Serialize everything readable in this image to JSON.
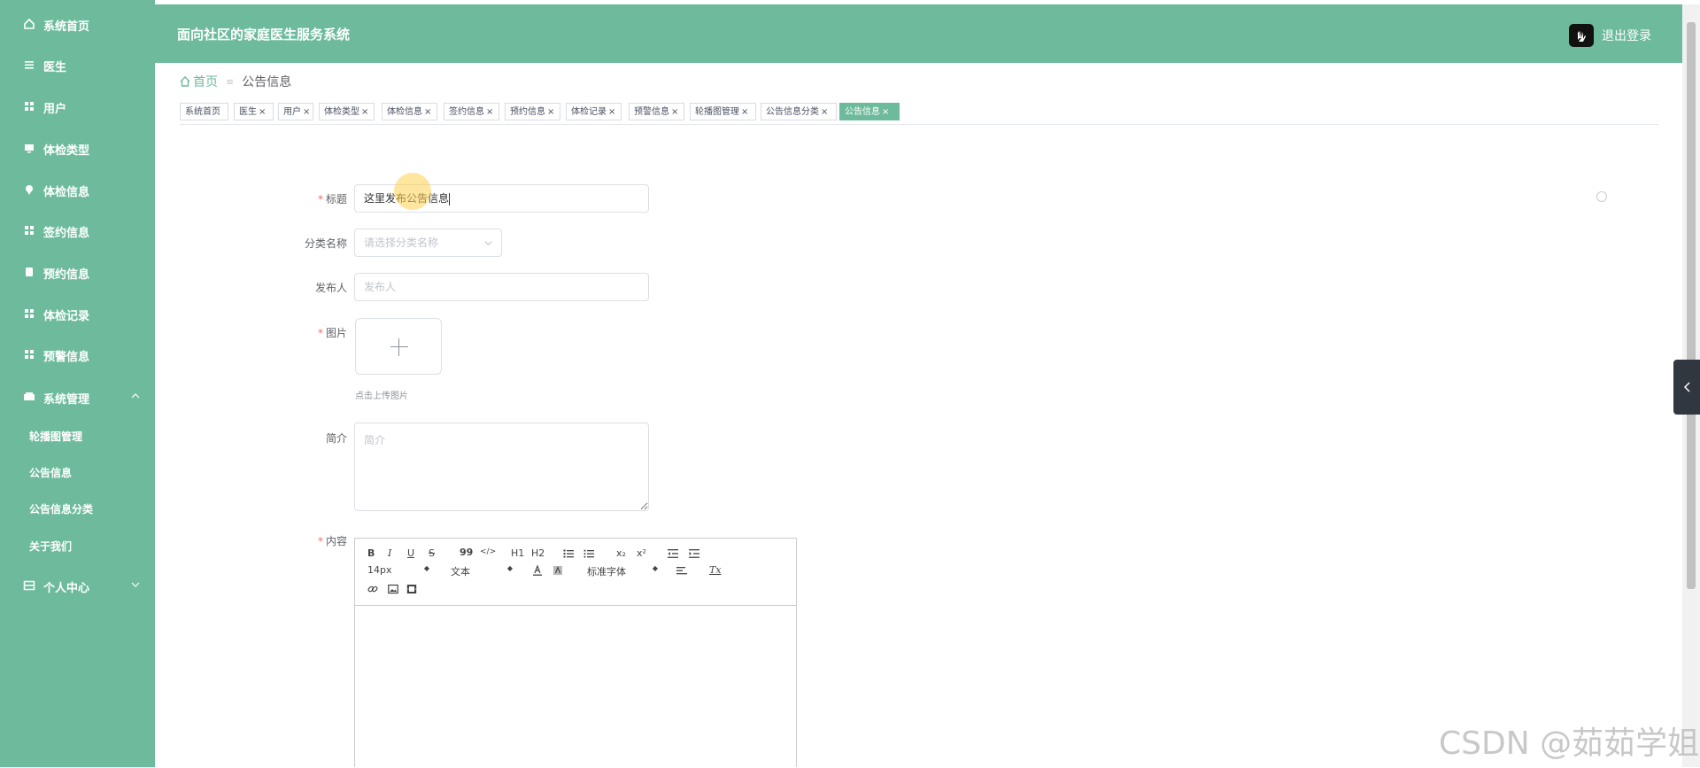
{
  "header": {
    "title": "面向社区的家庭医生服务系统",
    "logout_label": "退出登录"
  },
  "sidebar": {
    "items": [
      {
        "label": "系统首页",
        "icon": "home-icon"
      },
      {
        "label": "医生",
        "icon": "list-icon"
      },
      {
        "label": "用户",
        "icon": "grid-icon"
      },
      {
        "label": "体检类型",
        "icon": "monitor-icon"
      },
      {
        "label": "体检信息",
        "icon": "pin-icon"
      },
      {
        "label": "签约信息",
        "icon": "grid-icon"
      },
      {
        "label": "预约信息",
        "icon": "clipboard-icon"
      },
      {
        "label": "体检记录",
        "icon": "grid-icon"
      },
      {
        "label": "预警信息",
        "icon": "grid-icon"
      },
      {
        "label": "系统管理",
        "icon": "ticket-icon",
        "expanded": true
      },
      {
        "label": "个人中心",
        "icon": "card-icon",
        "expanded": false
      }
    ],
    "sub_items": [
      "轮播图管理",
      "公告信息",
      "公告信息分类",
      "关于我们"
    ]
  },
  "breadcrumb": {
    "home": "首页",
    "separator": "≡",
    "current": "公告信息"
  },
  "tags": [
    {
      "label": "系统首页",
      "closable": false
    },
    {
      "label": "医生",
      "closable": true
    },
    {
      "label": "用户",
      "closable": true
    },
    {
      "label": "体检类型",
      "closable": true
    },
    {
      "label": "体检信息",
      "closable": true
    },
    {
      "label": "签约信息",
      "closable": true
    },
    {
      "label": "预约信息",
      "closable": true
    },
    {
      "label": "体检记录",
      "closable": true
    },
    {
      "label": "预警信息",
      "closable": true
    },
    {
      "label": "轮播图管理",
      "closable": true
    },
    {
      "label": "公告信息分类",
      "closable": true
    },
    {
      "label": "公告信息",
      "closable": true,
      "active": true
    }
  ],
  "form": {
    "title": {
      "label": "标题",
      "required": true,
      "value": "这里发布公告信息"
    },
    "category": {
      "label": "分类名称",
      "placeholder": "请选择分类名称"
    },
    "publisher": {
      "label": "发布人",
      "placeholder": "发布人"
    },
    "image": {
      "label": "图片",
      "required": true,
      "hint": "点击上传图片"
    },
    "summary": {
      "label": "简介",
      "placeholder": "简介"
    },
    "content": {
      "label": "内容",
      "required": true
    }
  },
  "editor": {
    "bold": "B",
    "italic": "I",
    "underline": "U",
    "strike": "S",
    "quote": "99",
    "code": "</>",
    "h1": "H1",
    "h2": "H2",
    "sub": "x₂",
    "sup": "x²",
    "size": "14px",
    "header": "文本",
    "font": "标准字体",
    "clean": "Tx"
  },
  "watermark": "CSDN @茹茹学姐",
  "colors": {
    "primary": "#6dbb9c",
    "required": "#f56c6c"
  }
}
